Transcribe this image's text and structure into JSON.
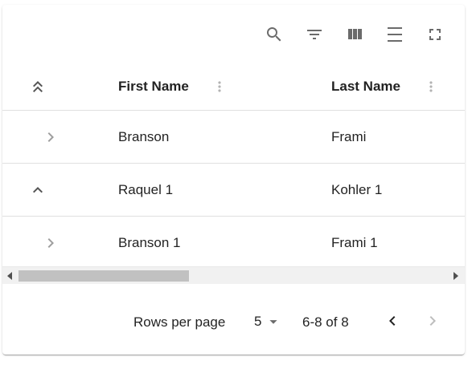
{
  "toolbar": {
    "buttons": [
      {
        "name": "search-icon"
      },
      {
        "name": "filter-icon"
      },
      {
        "name": "columns-icon"
      },
      {
        "name": "density-icon"
      },
      {
        "name": "fullscreen-icon"
      }
    ]
  },
  "table": {
    "columns": [
      {
        "label": "First Name"
      },
      {
        "label": "Last Name"
      }
    ],
    "rows": [
      {
        "first": "Branson",
        "last": "Frami",
        "expander": "chevron-right-icon",
        "subrow": true
      },
      {
        "first": "Raquel 1",
        "last": "Kohler 1",
        "expander": "chevron-up-icon",
        "subrow": false
      },
      {
        "first": "Branson 1",
        "last": "Frami 1",
        "expander": "chevron-right-icon",
        "subrow": true
      }
    ]
  },
  "pagination": {
    "rows_per_page_label": "Rows per page",
    "rows_per_page_value": "5",
    "range": "6-8 of 8"
  },
  "colors": {
    "icon": "#6b6b6b",
    "divider": "#e0e0e0",
    "scroll_thumb": "#c1c1c1",
    "disabled": "#bdbdbd"
  }
}
